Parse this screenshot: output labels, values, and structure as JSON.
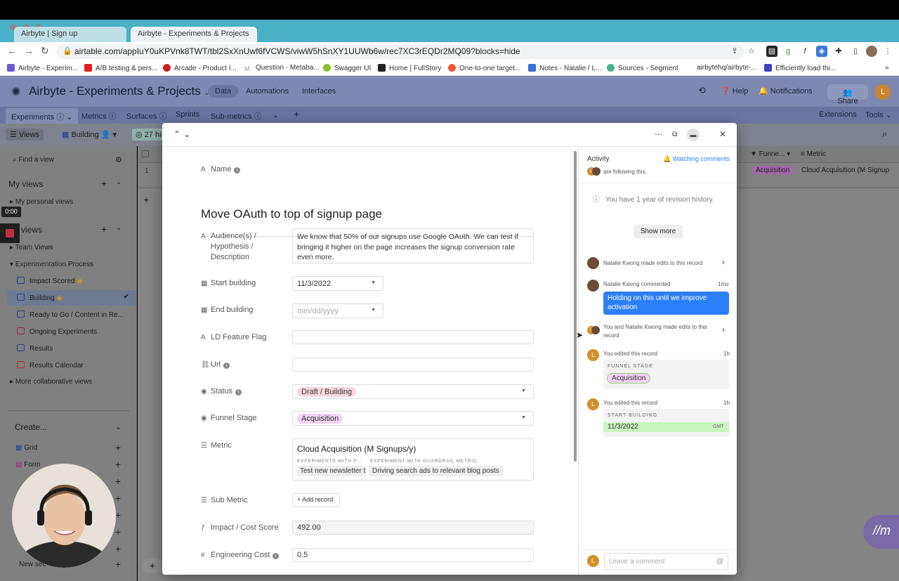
{
  "browser": {
    "tabs": [
      "Airbyte | Sign up",
      "Airbyte - Experiments & Projects"
    ],
    "url": "airtable.com/appIuY0uKPVnk8TWT/tbl2SxXnUwf6fVCWS/viwW5hSnXY1UUWb6w/rec7XC3rEQDr2MQ09?blocks=hide",
    "bookmarks": [
      "Airbyte - Experim...",
      "A/B testing & pers...",
      "Arcade - Product I...",
      "Question · Metaba...",
      "Swagger UI",
      "Home | FullStory",
      "One-to-one target...",
      "Notes - Natalie / L...",
      "Sources - Segment",
      "airbytehq/airbyte-...",
      "Efficiently load thi..."
    ]
  },
  "app": {
    "title": "Airbyte - Experiments & Projects",
    "nav": [
      "Data",
      "Automations",
      "Interfaces"
    ],
    "help": "Help",
    "notifications": "Notifications",
    "share": "Share",
    "avatar_initial": "L"
  },
  "table_tabs": [
    "Experiments",
    "Metrics",
    "Surfaces",
    "Sprints",
    "Sub-metrics"
  ],
  "table_right": [
    "Extensions",
    "Tools"
  ],
  "viewbar": {
    "views": "Views",
    "current": "Building",
    "hidden": "27 hi"
  },
  "sidebar": {
    "find": "Find a view",
    "my_views": "My views",
    "my_personal": "My personal views",
    "views_header": "views",
    "team_views": "Team Views",
    "process": "Experimentation Process",
    "items": [
      "Impact Scored",
      "Building",
      "Ready to Go / Content in Re...",
      "Ongoing Experiments",
      "Results",
      "Results Calendar"
    ],
    "more": "More collaborative views",
    "create": "Create...",
    "create_items": [
      "Grid",
      "Form"
    ],
    "new_section": "New sec"
  },
  "grid": {
    "row_num": "1",
    "col_funnel": "Funne...",
    "col_metric": "Metric",
    "cell_funnel": "Acquisition",
    "cell_metric": "Cloud Acquisition (M Signup"
  },
  "record": {
    "name_label": "Name",
    "name": "Move OAuth to top of signup page",
    "fields": {
      "audience_label": "Audience(s) /\nHypothesis /\nDescription",
      "audience_value": "We know that 50% of our signups use Google OAuth. We can test if bringing it higher on the page increases the signup conversion rate even more.",
      "start_label": "Start building",
      "start_value": "11/3/2022",
      "end_label": "End building",
      "end_placeholder": "mm/dd/yyyy",
      "ld_label": "LD Feature Flag",
      "url_label": "Url",
      "status_label": "Status",
      "status_value": "Draft / Building",
      "funnel_label": "Funnel Stage",
      "funnel_value": "Acquisition",
      "metric_label": "Metric",
      "metric_value": "Cloud Acquisition (M Signups/y)",
      "metric_sub1": "EXPERIMENTS WITH P...",
      "metric_sub2": "EXPERIMENT WITH GUARDRAIL METRIC",
      "metric_link1": "Test new newsletter t",
      "metric_link2": "Driving search ads to relevant blog posts",
      "submetric_label": "Sub Metric",
      "add_record": "Add record",
      "impact_label": "Impact / Cost Score",
      "impact_value": "492.00",
      "eng_label": "Engineering Cost",
      "eng_value": "0.5"
    }
  },
  "activity": {
    "title": "Activity",
    "watching": "Watching comments",
    "following": "are following this.",
    "revision": "You have 1 year of revision history.",
    "show_more": "Show more",
    "e1": "Natalie Kwong made edits to this record",
    "e2_who": "Natalie Kwong commented",
    "e2_time": "1mo",
    "e2_comment": "Holding on this until we improve activation",
    "e3": "You and Natalie Kwong made edits to this record",
    "e4": "You edited this record",
    "e4_time": "1h",
    "e4_label": "FUNNEL STAGE",
    "e4_value": "Acquisition",
    "e5": "You edited this record",
    "e5_time": "1h",
    "e5_label": "START BUILDING",
    "e5_value": "11/3/2022",
    "e5_tz": "GMT",
    "comment_placeholder": "Leave a comment"
  },
  "overlay": {
    "timer": "0:00",
    "logo": "//m"
  },
  "colors": {
    "accent": "#2d7ff9",
    "header": "#7e88b0",
    "status_pill": "#f9d6dd",
    "funnel_pill": "#f0d3f5",
    "date_highlight": "#c9f5c0"
  }
}
